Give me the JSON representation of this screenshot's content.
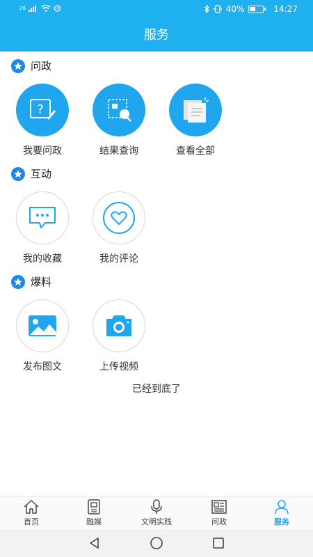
{
  "status_bar": {
    "battery": "40%",
    "time": "14:27",
    "network": "26",
    "battery_level": 0.4
  },
  "header": {
    "title": "服务"
  },
  "sections": {
    "wenzheng": {
      "title": "问政",
      "items": [
        {
          "label": "我要问政",
          "icon": "ask-question-icon"
        },
        {
          "label": "结果查询",
          "icon": "search-document-icon"
        },
        {
          "label": "查看全部",
          "icon": "view-all-documents-icon"
        }
      ]
    },
    "hudong": {
      "title": "互动",
      "items": [
        {
          "label": "我的收藏",
          "icon": "message-bubble-icon"
        },
        {
          "label": "我的评论",
          "icon": "heart-icon"
        }
      ]
    },
    "baoliao": {
      "title": "爆料",
      "items": [
        {
          "label": "发布图文",
          "icon": "image-icon"
        },
        {
          "label": "上传视频",
          "icon": "camera-icon"
        }
      ]
    }
  },
  "end_text": "已经到底了",
  "tabbar": {
    "tabs": [
      {
        "label": "首页",
        "icon": "home-icon"
      },
      {
        "label": "融媒",
        "icon": "media-icon"
      },
      {
        "label": "文明实践",
        "icon": "microphone-icon"
      },
      {
        "label": "问政",
        "icon": "newspaper-icon"
      },
      {
        "label": "服务",
        "icon": "user-icon",
        "active": true
      }
    ]
  },
  "colors": {
    "brand": "#1fb0f0",
    "accent": "#1fa6ee",
    "star": "#1e88e5"
  }
}
